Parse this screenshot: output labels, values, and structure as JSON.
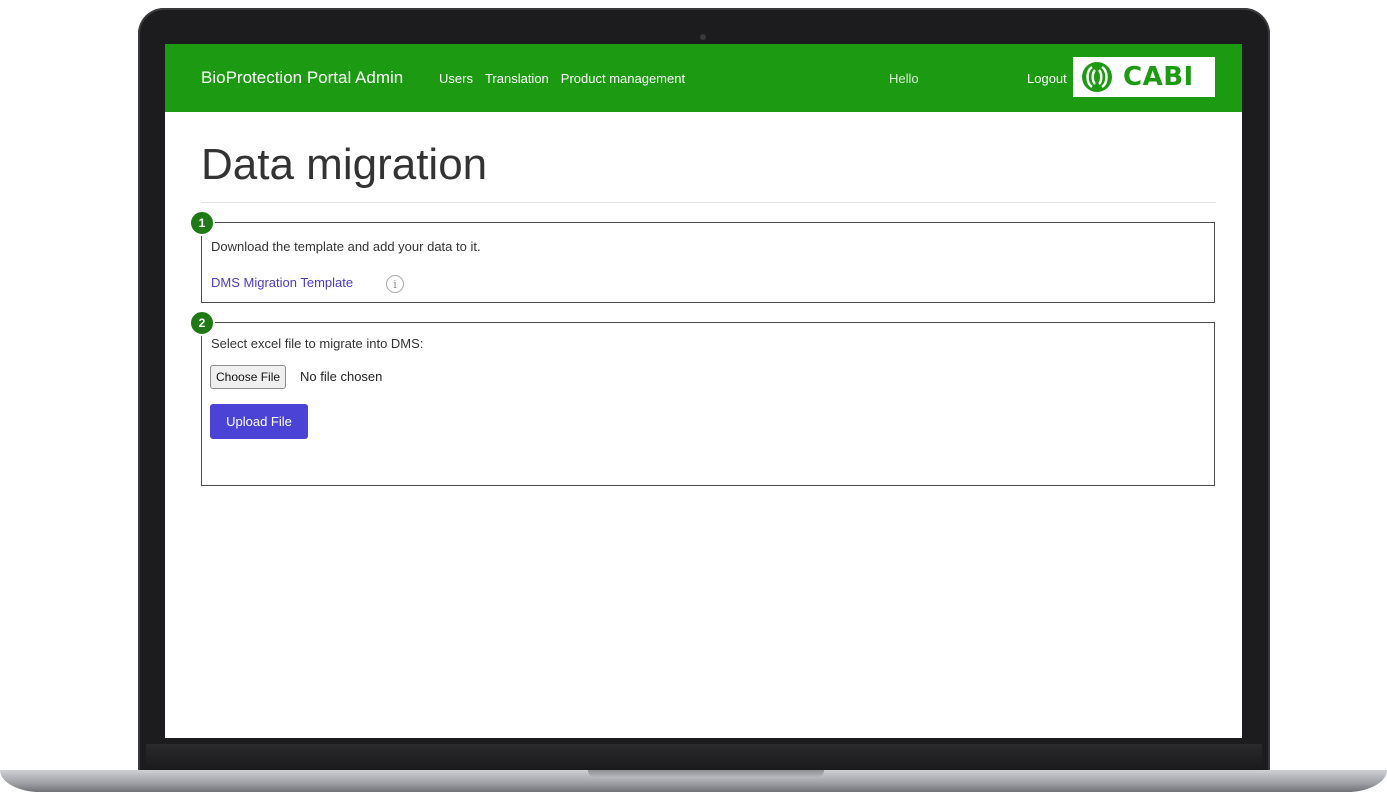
{
  "navbar": {
    "brand": "BioProtection Portal Admin",
    "links": [
      "Users",
      "Translation",
      "Product management"
    ],
    "greeting": "Hello",
    "logout": "Logout",
    "logo_text": "CABI"
  },
  "page": {
    "title": "Data migration"
  },
  "step1": {
    "number": "1",
    "instruction": "Download the template and add your data to it.",
    "template_link": "DMS Migration Template",
    "info_icon": "info-icon"
  },
  "step2": {
    "number": "2",
    "instruction": "Select excel file to migrate into DMS:",
    "choose_file_label": "Choose File",
    "file_status": "No file chosen",
    "upload_label": "Upload File"
  },
  "colors": {
    "navbar": "#1c9a11",
    "primary_button": "#4a43d6",
    "link": "#4b3bc0",
    "step_badge": "#1f7a16"
  }
}
